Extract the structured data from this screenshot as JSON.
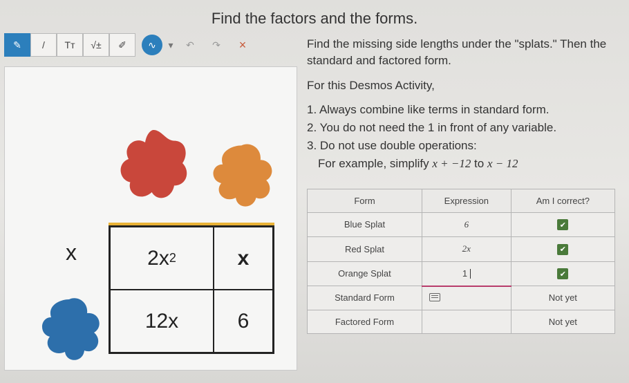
{
  "title": "Find the factors and the forms.",
  "toolbar": {
    "pen_active": "✎",
    "pen": "/",
    "text": "Tᴛ",
    "math": "√±",
    "erase": "⌫",
    "draw": "∿",
    "dropdown": "▾",
    "undo": "↶",
    "redo": "↷",
    "close": "×"
  },
  "splats": {
    "blue": "",
    "red": "",
    "orange": ""
  },
  "area_model": {
    "left_label": "x",
    "cells": {
      "top_left_html": "2x<sup>2</sup>",
      "top_right": "x",
      "bottom_left": "12x",
      "bottom_right": "6"
    }
  },
  "instructions": {
    "line1": "Find the missing side lengths under the \"splats.\" Then the standard and factored form.",
    "line2": "For this Desmos Activity,",
    "item1": "1. Always combine like terms in standard form.",
    "item2": "2. You do not need the 1 in front of any variable.",
    "item3": "3. Do not use double operations:",
    "item3b_prefix": "For example, simplify ",
    "item3b_math1": "x + −12",
    "item3b_mid": " to ",
    "item3b_math2": "x − 12"
  },
  "table": {
    "headers": {
      "form": "Form",
      "expression": "Expression",
      "correct": "Am I correct?"
    },
    "rows": [
      {
        "form": "Blue Splat",
        "expr": "6",
        "status": "check"
      },
      {
        "form": "Red Splat",
        "expr": "2x",
        "status": "check"
      },
      {
        "form": "Orange Splat",
        "expr": "1",
        "status": "check"
      },
      {
        "form": "Standard Form",
        "expr": "",
        "status": "notyet"
      },
      {
        "form": "Factored Form",
        "expr": "",
        "status": "notyet"
      }
    ],
    "notyet_label": "Not yet",
    "check_glyph": "✔"
  }
}
